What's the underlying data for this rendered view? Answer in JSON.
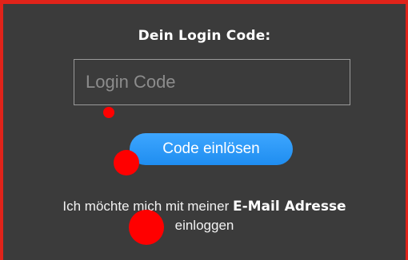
{
  "login": {
    "title": "Dein Login Code:",
    "code_placeholder": "Login Code",
    "submit_label": "Code einlösen",
    "email_prefix": "Ich möchte mich mit meiner ",
    "email_link": "E-Mail Adresse",
    "email_suffix": "einloggen"
  },
  "colors": {
    "panel_bg": "#3b3b3b",
    "border": "#e0231a",
    "button": "#2196f3",
    "marker": "#ff0000"
  }
}
